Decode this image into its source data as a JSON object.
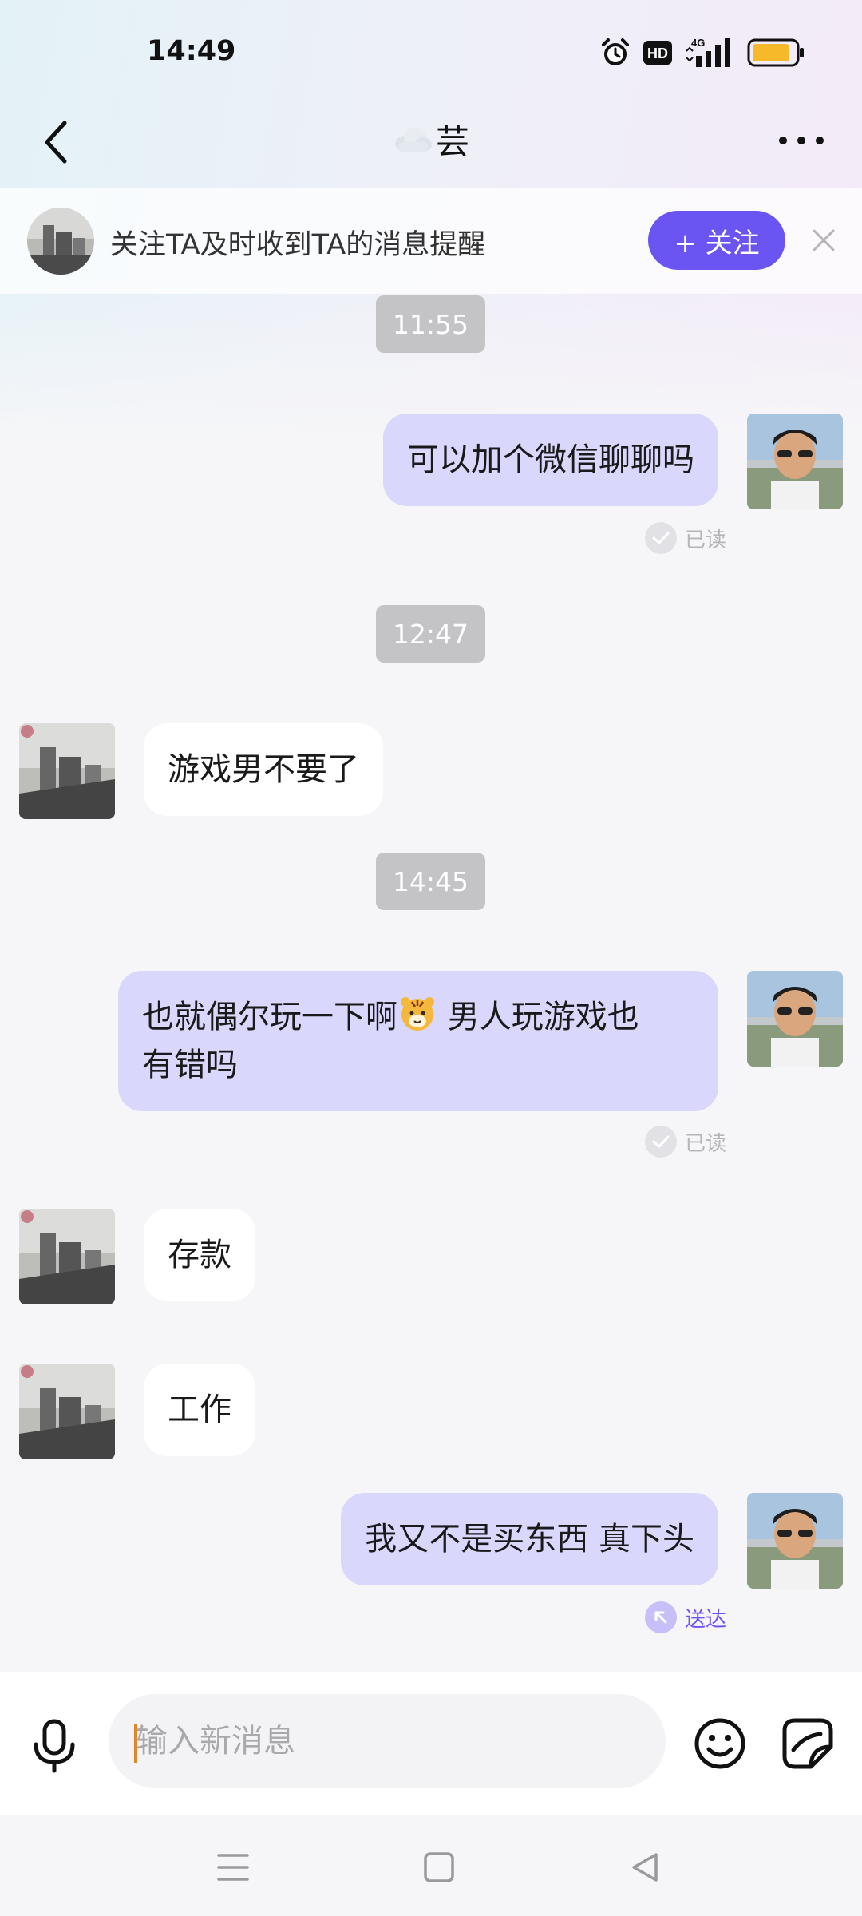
{
  "status_bar": {
    "time": "14:49",
    "icons": [
      "alarm-icon",
      "hd-icon",
      "signal-4g-icon",
      "battery-icon"
    ],
    "hd_label": "HD",
    "network_label": "4G"
  },
  "header": {
    "title_icon": "cloud-emoji",
    "title": "芸",
    "back_icon": "chevron-left-icon",
    "more_icon": "more-horizontal-icon"
  },
  "follow_banner": {
    "text": "关注TA及时收到TA的消息提醒",
    "button_label": "+ 关注",
    "close_icon": "close-icon"
  },
  "messages": [
    {
      "type": "time",
      "text": "11:55"
    },
    {
      "type": "sent",
      "text": "可以加个微信聊聊吗",
      "receipt": "已读"
    },
    {
      "type": "time",
      "text": "12:47"
    },
    {
      "type": "received",
      "text": "游戏男不要了"
    },
    {
      "type": "time",
      "text": "14:45"
    },
    {
      "type": "sent",
      "text_before_emoji": "也就偶尔玩一下啊",
      "emoji": "tiger-emoji",
      "text_after_emoji": " 男人玩游戏也",
      "text_line2": "有错吗",
      "receipt": "已读"
    },
    {
      "type": "received",
      "text": "存款"
    },
    {
      "type": "received",
      "text": "工作"
    },
    {
      "type": "sent",
      "text": "我又不是买东西  真下头",
      "receipt": "送达"
    }
  ],
  "input_bar": {
    "placeholder": "输入新消息",
    "value": "",
    "icons": [
      "microphone-icon",
      "emoji-icon",
      "sticker-icon"
    ]
  },
  "nav_bar": {
    "icons": [
      "menu-icon",
      "home-icon",
      "back-icon"
    ]
  },
  "colors": {
    "accent": "#6b55f2",
    "sent_bubble": "#d9d7fb",
    "received_bubble": "#ffffff",
    "timestamp_bg": "#c4c4c7",
    "caret": "#e0862a"
  }
}
